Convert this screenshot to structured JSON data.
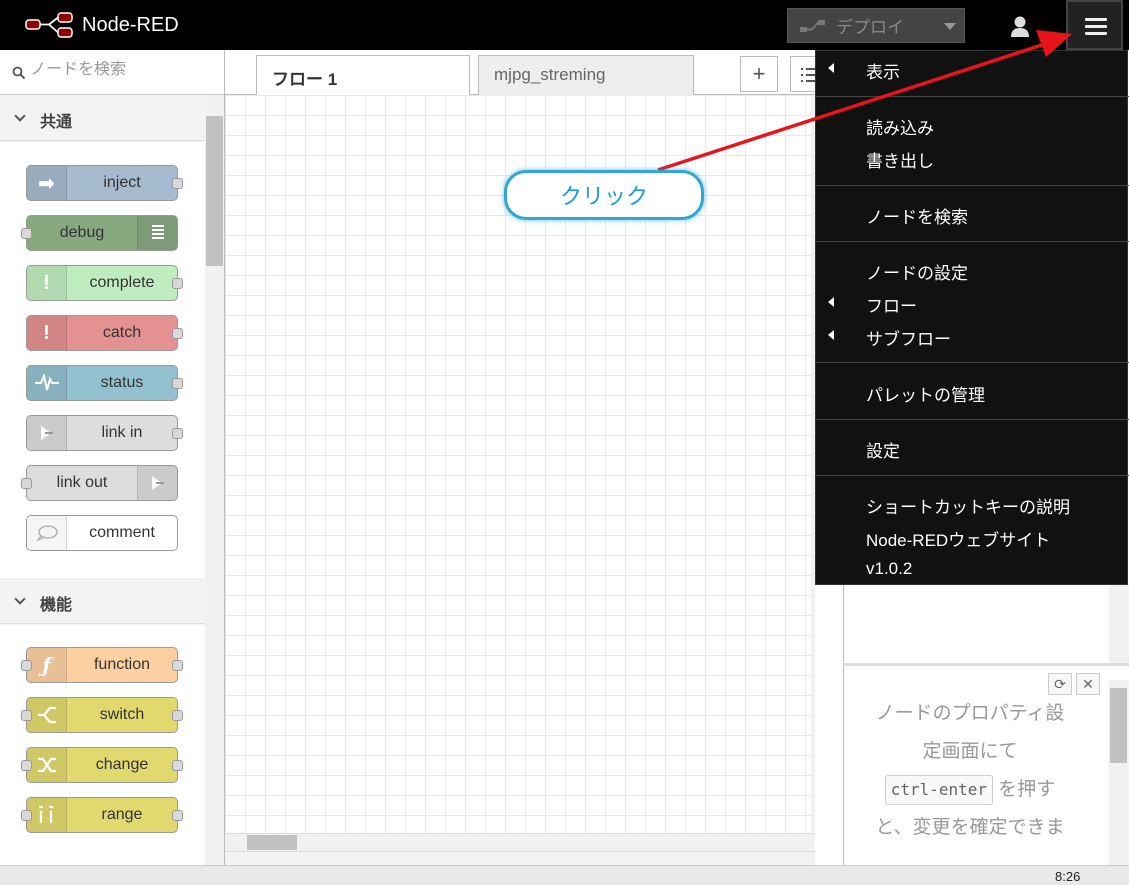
{
  "header": {
    "app_title": "Node-RED",
    "deploy_label": "デプロイ"
  },
  "palette": {
    "search_placeholder": "ノードを検索",
    "categories": [
      {
        "label": "共通",
        "nodes": [
          "inject",
          "debug",
          "complete",
          "catch",
          "status",
          "link in",
          "link out",
          "comment"
        ]
      },
      {
        "label": "機能",
        "nodes": [
          "function",
          "switch",
          "change",
          "range"
        ]
      }
    ]
  },
  "workspace": {
    "tabs": [
      "フロー 1",
      "mjpg_streming"
    ],
    "add_tab_label": "+"
  },
  "menu": {
    "items": [
      "表示",
      "読み込み",
      "書き出し",
      "ノードを検索",
      "ノードの設定",
      "フロー",
      "サブフロー",
      "パレットの管理",
      "設定",
      "ショートカットキーの説明",
      "Node-REDウェブサイト",
      "v1.0.2"
    ]
  },
  "sidebar": {
    "help_text_1": "ノードのプロパティ設",
    "help_text_2": "定画面にて",
    "help_kbd": "ctrl-enter",
    "help_text_3": "を押す",
    "help_text_4": "と、変更を確定できま"
  },
  "annotation": {
    "callout": "クリック"
  },
  "taskbar": {
    "clock": "8:26"
  },
  "colors": {
    "inject": "#a6bbcf",
    "debug": "#87a980",
    "complete": "#c0edc0",
    "catch": "#e49191",
    "status": "#94c1d0",
    "link": "#dddddd",
    "comment": "#ffffff",
    "function": "#fdd0a2",
    "switch": "#e2d96e",
    "arrow": "#e8141b",
    "callout_border": "#2fa6d6"
  },
  "icons": [
    "node-red-logo",
    "user-icon",
    "hamburger-menu-icon",
    "search-icon",
    "chevron-down-icon",
    "arrow-right-icon",
    "list-icon",
    "exclamation-icon",
    "pulse-icon",
    "link-icon",
    "speech-bubble-icon",
    "function-icon",
    "switch-icon",
    "shuffle-icon",
    "range-icon",
    "refresh-icon",
    "close-icon"
  ]
}
